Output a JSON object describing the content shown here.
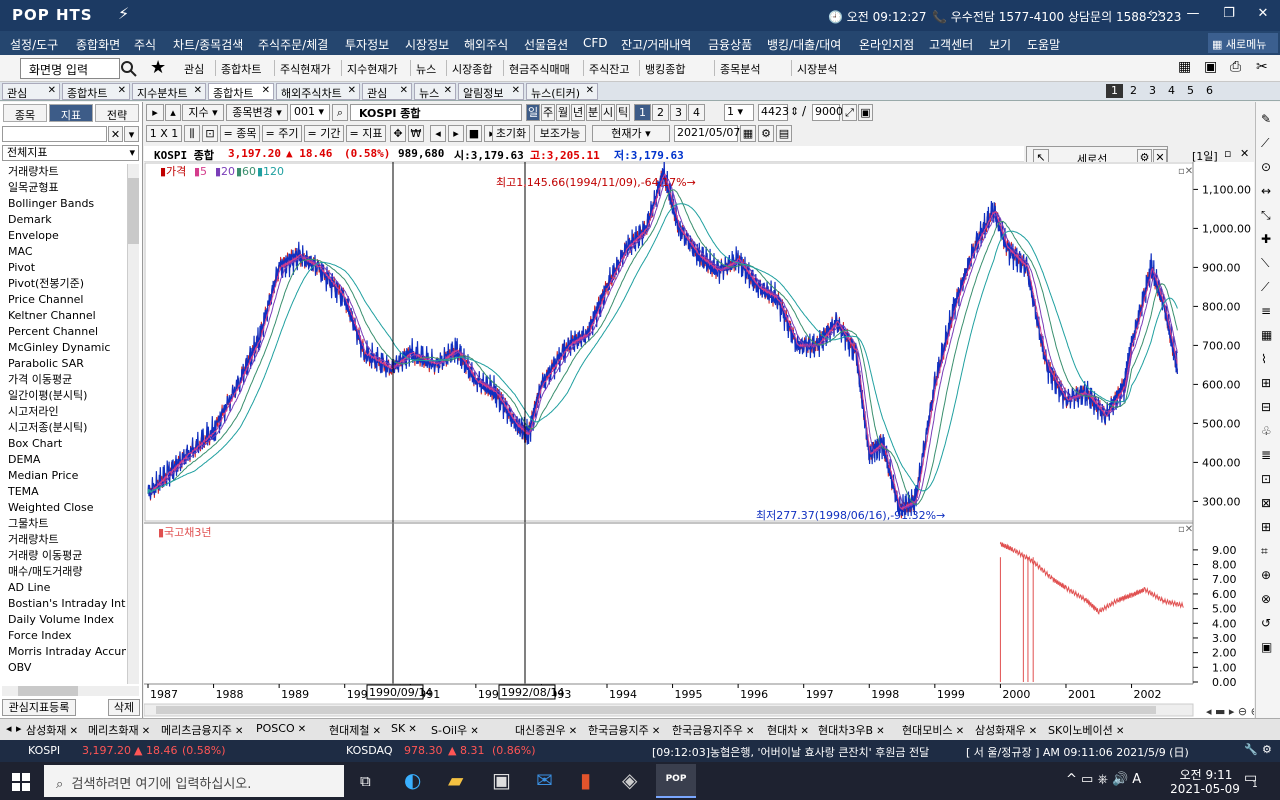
{
  "titlebar": {
    "logo": "POP HTS",
    "clock": "오전 09:12:27",
    "contact": "우수전담 1577-4100 상담문의 1588-2323"
  },
  "menu": {
    "items": [
      "설정/도구",
      "종합화면",
      "주식",
      "차트/종목검색",
      "주식주문/체결",
      "투자정보",
      "시장정보",
      "해외주식",
      "선물옵션",
      "CFD",
      "잔고/거래내역",
      "금융상품",
      "뱅킹/대출/대여",
      "온라인지점",
      "고객센터",
      "보기",
      "도움말"
    ],
    "new_window": "새로메뉴"
  },
  "toolbar": {
    "screen_input": "화면명 입력",
    "items": [
      "관심",
      "종합차트",
      "주식현재가",
      "지수현재가",
      "뉴스",
      "시장종합",
      "현금주식매매",
      "주식잔고",
      "뱅킹종합",
      "종목분석",
      "시장분석"
    ]
  },
  "tabs": [
    "관심",
    "종합차트",
    "지수분차트",
    "종합차트",
    "해외주식차트",
    "관심",
    "뉴스",
    "알림정보",
    "뉴스(티커)"
  ],
  "pages": [
    "1",
    "2",
    "3",
    "4",
    "5",
    "6"
  ],
  "leftpanel": {
    "tabs": [
      "종목",
      "지표",
      "전략"
    ],
    "dropdown": "전체지표",
    "indicators": [
      "거래량차트",
      "일목균형표",
      "Bollinger Bands",
      "Demark",
      "Envelope",
      "MAC",
      "Pivot",
      "Pivot(전봉기준)",
      "Price Channel",
      "Keltner Channel",
      "Percent Channel",
      "McGinley Dynamic",
      "Parabolic SAR",
      "가격 이동평균",
      "일간이평(분시틱)",
      "시고저라인",
      "시고저종(분시틱)",
      "Box Chart",
      "DEMA",
      "Median Price",
      "TEMA",
      "Weighted Close",
      "그물차트",
      "거래량차트",
      "거래량 이동평균",
      "매수/매도거래량",
      "AD Line",
      "Bostian's Intraday Intens",
      "Daily Volume Index",
      "Force Index",
      "Morris Intraday Accumu",
      "OBV"
    ],
    "register_btn": "관심지표등록",
    "delete_btn": "삭제"
  },
  "chartctrl": {
    "mode": "지수",
    "change_btn": "종목변경",
    "code": "001",
    "name": "KOSPI 종합",
    "periods": [
      "일",
      "주",
      "월",
      "년",
      "분",
      "시",
      "틱"
    ],
    "nums": [
      "1",
      "2",
      "3",
      "4"
    ],
    "unit": "1",
    "count": "4423",
    "total": "9000",
    "ratio": "1 X 1",
    "buttons": [
      "= 종목",
      "= 주기",
      "= 기간",
      "= 지표"
    ],
    "reset": "초기화",
    "aux": "보조가능",
    "price_type": "현재가",
    "date": "2021/05/07"
  },
  "info": {
    "name": "KOSPI 종합",
    "price": "3,197.20",
    "change": "18.46",
    "pct": "(0.58%)",
    "volume": "989,680",
    "open": "시:3,179.63",
    "high": "고:3,205.11",
    "low": "저:3,179.63"
  },
  "floatpanel": {
    "title": "세로선",
    "period": "[1일]"
  },
  "legend": {
    "price": "가격",
    "ma": [
      "5",
      "20",
      "60",
      "120"
    ],
    "sub": "국고채3년"
  },
  "annot": {
    "high": "최고1,145.66(1994/11/09),-64.17%",
    "low": "최저277.37(1998/06/16),-91.32%",
    "vline1": "1990/09/14",
    "vline2": "1992/08/14"
  },
  "chart_data": {
    "type": "line",
    "title": "KOSPI 종합",
    "x_axis": [
      "1987",
      "1988",
      "1989",
      "1990",
      "1991",
      "1992",
      "1993",
      "1994",
      "1995",
      "1996",
      "1997",
      "1998",
      "1999",
      "2000",
      "2001",
      "2002"
    ],
    "y_ticks": [
      "1,100.00",
      "1,000.00",
      "900.00",
      "800.00",
      "700.00",
      "600.00",
      "500.00",
      "400.00",
      "300.00"
    ],
    "ylim": [
      260,
      1160
    ],
    "series": [
      {
        "name": "가격",
        "x": [
          1987.0,
          1987.3,
          1987.6,
          1988.0,
          1988.4,
          1988.7,
          1989.0,
          1989.3,
          1989.6,
          1990.0,
          1990.3,
          1990.7,
          1991.0,
          1991.4,
          1991.7,
          1992.0,
          1992.3,
          1992.6,
          1992.8,
          1993.0,
          1993.4,
          1993.7,
          1994.0,
          1994.3,
          1994.6,
          1994.86,
          1995.1,
          1995.4,
          1995.7,
          1996.0,
          1996.3,
          1996.6,
          1996.9,
          1997.2,
          1997.5,
          1997.8,
          1998.0,
          1998.2,
          1998.46,
          1998.7,
          1999.0,
          1999.3,
          1999.6,
          1999.9,
          2000.1,
          2000.4,
          2000.7,
          2001.0,
          2001.3,
          2001.6,
          2001.9,
          2002.0,
          2002.3,
          2002.5,
          2002.7
        ],
        "values": [
          320,
          370,
          420,
          480,
          610,
          720,
          900,
          930,
          900,
          820,
          680,
          640,
          680,
          650,
          690,
          610,
          580,
          500,
          470,
          600,
          700,
          730,
          850,
          950,
          1000,
          1145,
          1000,
          930,
          890,
          920,
          850,
          820,
          700,
          700,
          760,
          680,
          420,
          450,
          280,
          300,
          600,
          800,
          950,
          1050,
          950,
          900,
          650,
          560,
          580,
          520,
          600,
          700,
          900,
          800,
          640
        ]
      },
      {
        "name": "국고채3년",
        "x": [
          2000.0,
          2000.2,
          2000.5,
          2000.8,
          2001.0,
          2001.3,
          2001.5,
          2001.8,
          2002.0,
          2002.2,
          2002.5,
          2002.8
        ],
        "values": [
          9.4,
          9.0,
          8.2,
          7.0,
          6.4,
          5.6,
          4.8,
          5.6,
          5.9,
          6.3,
          5.5,
          5.2
        ]
      }
    ],
    "sub_y_ticks": [
      "9.00",
      "8.00",
      "7.00",
      "6.00",
      "5.00",
      "4.00",
      "3.00",
      "2.00",
      "1.00",
      "0.00"
    ]
  },
  "watchlist": [
    "삼성화재",
    "메리츠화재",
    "메리츠금융지주",
    "POSCO",
    "현대제철",
    "SK",
    "S-Oil우",
    "대신증권우",
    "한국금융지주",
    "한국금융지주우",
    "현대차",
    "현대차3우B",
    "현대모비스",
    "삼성화재우",
    "SK이노베이션"
  ],
  "ticker": {
    "kospi_label": "KOSPI",
    "kospi_value": "3,197.20",
    "kospi_change": "18.46",
    "kospi_pct": "(0.58%)",
    "kosdaq_label": "KOSDAQ",
    "kosdaq_value": "978.30",
    "kosdaq_change": "8.31",
    "kosdaq_pct": "(0.86%)",
    "news": "[09:12:03]농협은행, '어버이날 효사랑 큰잔치' 후원금 전달",
    "notice": "[ 서 울/정규장 ] AM 09:11:06  2021/5/9 (日)"
  },
  "taskbar": {
    "search": "검색하려면 여기에 입력하십시오.",
    "time": "오전 9:11",
    "date": "2021-05-09",
    "notif": "1"
  }
}
